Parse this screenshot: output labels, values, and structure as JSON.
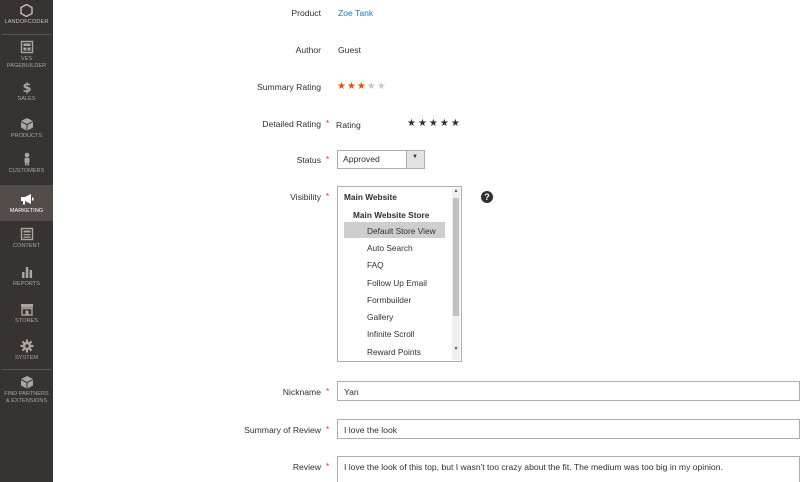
{
  "sidebar": {
    "logo_label": "LANDOFCODER",
    "items": [
      {
        "label1": "VES",
        "label2": "PAGEBUILDER",
        "icon": "pagebuilder-icon"
      },
      {
        "label1": "SALES",
        "label2": "",
        "icon": "dollar-icon"
      },
      {
        "label1": "PRODUCTS",
        "label2": "",
        "icon": "cube-icon"
      },
      {
        "label1": "CUSTOMERS",
        "label2": "",
        "icon": "person-icon"
      },
      {
        "label1": "MARKETING",
        "label2": "",
        "icon": "megaphone-icon"
      },
      {
        "label1": "CONTENT",
        "label2": "",
        "icon": "content-icon"
      },
      {
        "label1": "REPORTS",
        "label2": "",
        "icon": "bar-chart-icon"
      },
      {
        "label1": "STORES",
        "label2": "",
        "icon": "store-icon"
      },
      {
        "label1": "SYSTEM",
        "label2": "",
        "icon": "gear-icon"
      },
      {
        "label1": "FIND PARTNERS",
        "label2": "& EXTENSIONS",
        "icon": "extensions-icon"
      }
    ],
    "active_item": "MARKETING"
  },
  "form": {
    "product_label": "Product",
    "product_value": "Zoe Tank",
    "author_label": "Author",
    "author_value": "Guest",
    "summary_rating_label": "Summary Rating",
    "summary_rating_value": 3,
    "summary_rating_max": 5,
    "detailed_rating_label": "Detailed Rating",
    "detailed_rating_sub": "Rating",
    "detailed_rating_stars": "★★★★★",
    "summary_stars_on": "★★★",
    "summary_stars_off": "★★",
    "status_label": "Status",
    "status_value": "Approved",
    "visibility_label": "Visibility",
    "visibility_options": [
      {
        "label": "Main Website",
        "level": 0
      },
      {
        "label": "Main Website Store",
        "level": 1
      },
      {
        "label": "Default Store View",
        "level": 2,
        "selected": true
      },
      {
        "label": "Auto Search",
        "level": 2
      },
      {
        "label": "FAQ",
        "level": 2
      },
      {
        "label": "Follow Up Email",
        "level": 2
      },
      {
        "label": "Formbuilder",
        "level": 2
      },
      {
        "label": "Gallery",
        "level": 2
      },
      {
        "label": "Infinite Scroll",
        "level": 2
      },
      {
        "label": "Reward Points",
        "level": 2
      }
    ],
    "help_glyph": "?",
    "nickname_label": "Nickname",
    "nickname_value": "Yan",
    "summary_review_label": "Summary of Review",
    "summary_review_value": "I love the look",
    "review_label": "Review",
    "review_value": "I love the look of this top, but I wasn't too crazy about the fit. The medium was too big in my opinion.",
    "required_mark": "*"
  },
  "colors": {
    "sidebar_bg": "#373330",
    "sidebar_active": "#524d49",
    "link": "#1979c3",
    "star_on": "#eb5202",
    "required": "#e22626"
  }
}
